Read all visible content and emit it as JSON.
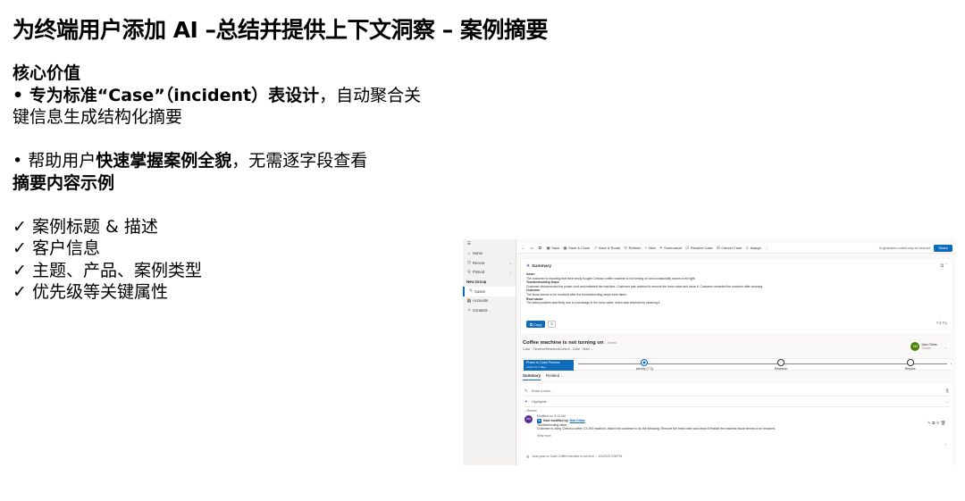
{
  "slide": {
    "title": "为终端用户添加 AI –总结并提供上下文洞察 – 案例摘要",
    "core_value_heading": "核心价值",
    "bullet1_bold": "• 专为标准“Case”（incident）表设计",
    "bullet1_rest": "，自动聚合关",
    "bullet1_cont": "键信息生成结构化摘要",
    "bullet2_prefix": "• 帮助用户",
    "bullet2_bold": "快速掌握案例全貌",
    "bullet2_rest": "，无需逐字段查看",
    "example_heading": "摘要内容示例",
    "checks": [
      "✓ 案例标题 & 描述",
      "✓ 客户信息",
      "✓ 主题、产品、案例类型",
      "✓ 优先级等关键属性"
    ]
  },
  "app": {
    "sidebar": {
      "menu_icon": "hamburger-icon",
      "items": [
        {
          "label": "Home",
          "icon": "home-icon"
        },
        {
          "label": "Recent",
          "icon": "clock-icon",
          "chevron": "⌄"
        },
        {
          "label": "Pinned",
          "icon": "pin-icon",
          "chevron": "⌄"
        }
      ],
      "group_label": "New Group",
      "group_items": [
        {
          "label": "Cases",
          "icon": "wrench-icon",
          "active": true
        },
        {
          "label": "Accounts",
          "icon": "building-icon"
        },
        {
          "label": "Contacts",
          "icon": "person-icon"
        }
      ]
    },
    "commands": [
      {
        "label": "Save",
        "icon": "save-icon"
      },
      {
        "label": "Save & Close",
        "icon": "save-close-icon"
      },
      {
        "label": "Save & Route",
        "icon": "route-icon"
      },
      {
        "label": "Refresh",
        "icon": "refresh-icon"
      },
      {
        "label": "New",
        "icon": "plus-icon"
      },
      {
        "label": "Summarize",
        "icon": "copilot-icon"
      },
      {
        "label": "Resolve Case",
        "icon": "document-check-icon"
      },
      {
        "label": "Cancel Case",
        "icon": "document-x-icon"
      },
      {
        "label": "Assign",
        "icon": "person-assign-icon"
      }
    ],
    "ai_note": "AI-generated content may be incorrect",
    "share_label": "Share",
    "summary": {
      "heading": "Summary",
      "issue_label": "Issue:",
      "issue_text": "The customer is reporting that their newly bought Contoso coffee machine is not turning on and occasionally shows a red light.",
      "troubleshooting_label": "Troubleshooting steps:",
      "troubleshooting_text": "Customer disconnected the power cord and restarted the machine. Customer was advised to remove the brew valve and clean it. Customer restarted the machine after cleaning.",
      "outcome_label": "Outcome:",
      "outcome_text": "The issue seems to be resolved after the troubleshooting steps were taken.",
      "rootcause_label": "Root cause:",
      "rootcause_text": "The initial problem was likely due to a blockage in the brew valve, which was resolved by cleaning it.",
      "copy_label": "Copy"
    },
    "case": {
      "title": "Coffee machine is not turning on",
      "saved": "- Saved",
      "subtitle": "Case · Timeline/ResolvedControl - Case · Main ⌄",
      "owner_initials": "MG",
      "owner_name": "Max Gibbs",
      "owner_role": "Owner"
    },
    "bpf": {
      "active_label": "Phase to Case Process",
      "active_days": "Active for 7 days",
      "stages": [
        {
          "label": "Identify (7 D)",
          "pos": 0.18,
          "current": true
        },
        {
          "label": "Research",
          "pos": 0.55,
          "current": false
        },
        {
          "label": "Resolve",
          "pos": 0.9,
          "current": false
        }
      ]
    },
    "tabs": [
      {
        "label": "Summary",
        "active": true
      },
      {
        "label": "Related",
        "chevron": "⌄"
      }
    ],
    "timeline": {
      "note_placeholder": "Enter a note...",
      "highlights_label": "Highlights",
      "recent_label": "Recent",
      "entry": {
        "initials": "MG",
        "modified_on": "Modified on: 5:10 AM",
        "note_by_prefix": "Note modified by:",
        "note_by_name": "Max Gibbs",
        "line1": "Troubleshooting steps",
        "line2": "Customer is using Contoso coffee CX 200 machine. Asked the customer to do the following: Remove the brew valve and clean it.Restart  the machine.Issue seems to be resolved.",
        "view_more": "View more"
      },
      "bottom_text": "Auto-post on Case Coffee machine is not turni...",
      "bottom_date": "4/3/2023 3:08 PM"
    }
  }
}
